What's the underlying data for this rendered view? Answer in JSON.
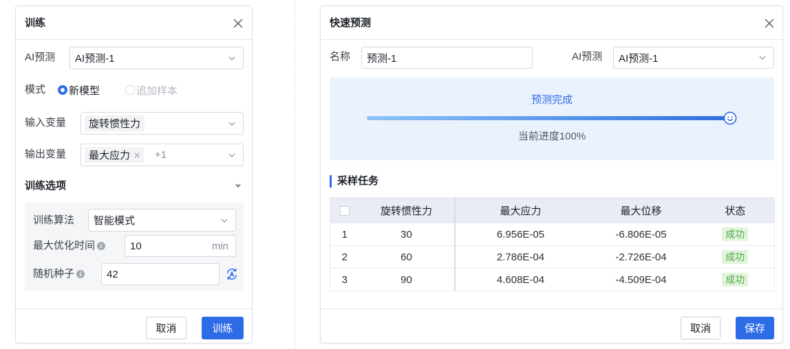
{
  "left_dialog": {
    "title": "训练",
    "ai_predict": {
      "label": "AI预测",
      "value": "AI预测-1"
    },
    "mode": {
      "label": "模式",
      "options": [
        {
          "label": "新模型",
          "selected": true,
          "disabled": false
        },
        {
          "label": "追加样本",
          "selected": false,
          "disabled": true
        }
      ]
    },
    "input_variables": {
      "label": "输入变量",
      "tags": [
        "旋转惯性力"
      ]
    },
    "output_variables": {
      "label": "输出变量",
      "tags": [
        "最大应力"
      ],
      "more": "+1"
    },
    "training_options": {
      "title": "训练选项",
      "algorithm": {
        "label": "训练算法",
        "value": "智能模式"
      },
      "max_time": {
        "label": "最大优化时间",
        "value": "10",
        "unit": "min"
      },
      "random_seed": {
        "label": "随机种子",
        "value": "42"
      }
    },
    "buttons": {
      "cancel": "取消",
      "confirm": "训练"
    }
  },
  "right_dialog": {
    "title": "快速预测",
    "name": {
      "label": "名称",
      "value": "预测-1"
    },
    "ai_predict": {
      "label": "AI预测",
      "value": "AI预测-1"
    },
    "progress": {
      "status": "预测完成",
      "percent": 100,
      "text": "当前进度100%"
    },
    "sampling": {
      "title": "采样任务",
      "columns": [
        "旋转惯性力",
        "最大应力",
        "最大位移",
        "状态"
      ],
      "rows": [
        {
          "index": "1",
          "rotation_inertia": "30",
          "max_stress": "6.956E-05",
          "max_displacement": "-6.806E-05",
          "status": "成功"
        },
        {
          "index": "2",
          "rotation_inertia": "60",
          "max_stress": "2.786E-04",
          "max_displacement": "-2.726E-04",
          "status": "成功"
        },
        {
          "index": "3",
          "rotation_inertia": "90",
          "max_stress": "4.608E-04",
          "max_displacement": "-4.509E-04",
          "status": "成功"
        }
      ]
    },
    "buttons": {
      "cancel": "取消",
      "save": "保存"
    }
  },
  "colors": {
    "primary": "#2E6BE6",
    "progress_start": "#8EC3F7",
    "progress_end": "#2F6FE0",
    "progress_track": "#D3E3F8",
    "progress_panel_bg": "#EAF3FD",
    "success_text": "#52A84A",
    "success_bg": "#E2F5DC",
    "table_header_bg": "#E8EDF4",
    "options_panel_bg": "#F5F6F8"
  },
  "icons": {
    "close": "close-icon",
    "dropdown": "chevron-down-icon",
    "collapse": "caret-down-icon",
    "info": "info-icon",
    "seed": "regenerate-seed-icon",
    "tag_remove": "tag-close-icon",
    "progress_end": "smiley-icon"
  }
}
